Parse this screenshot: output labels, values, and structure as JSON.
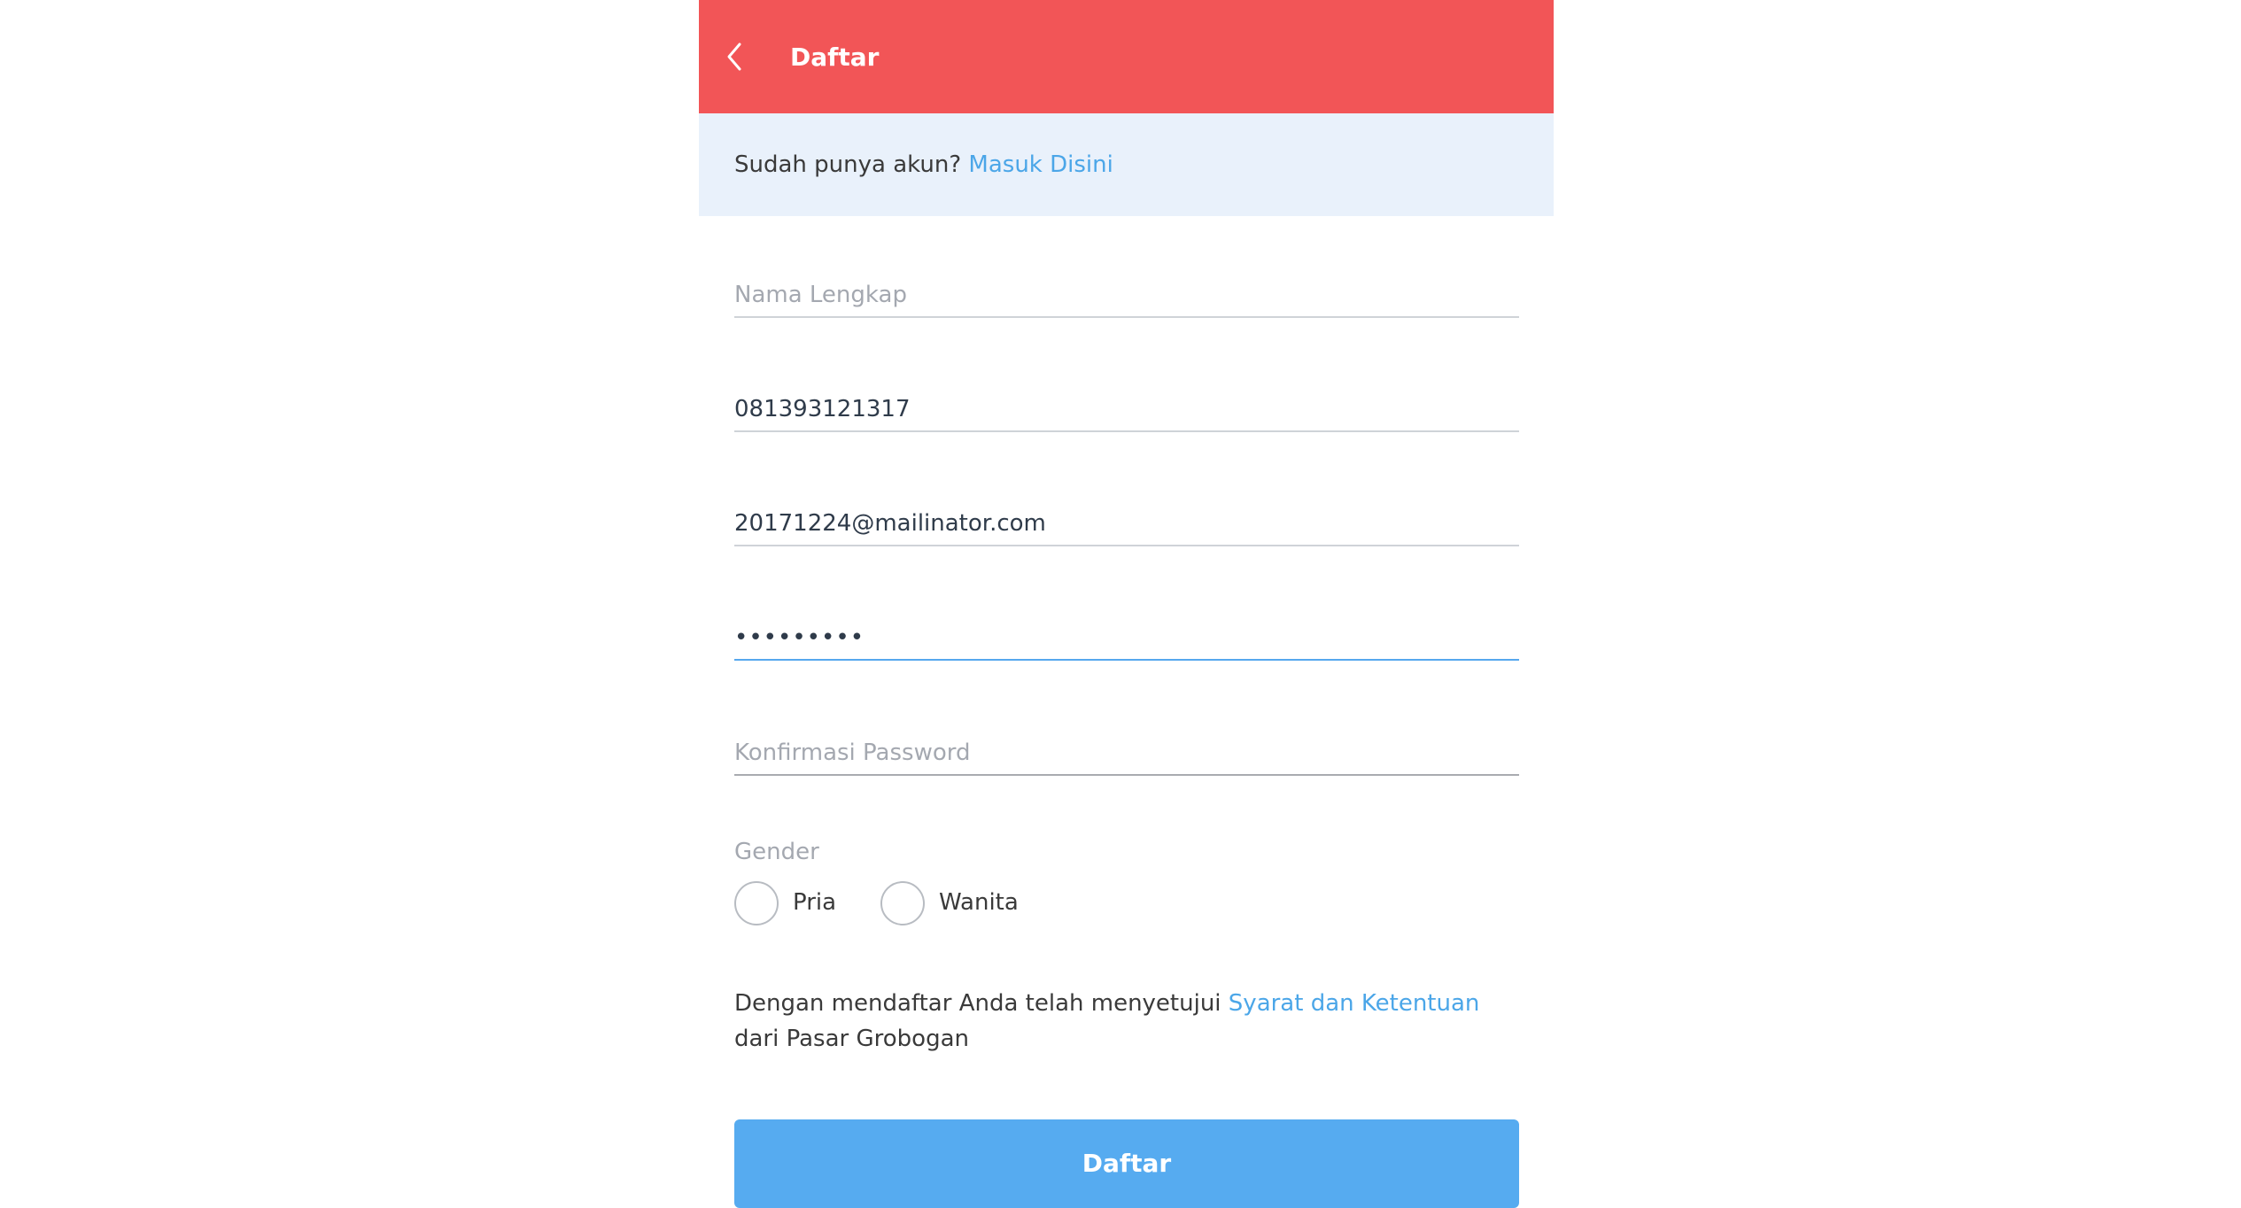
{
  "header": {
    "title": "Daftar",
    "back_icon": "chevron-left-icon",
    "background": "#f25557"
  },
  "login_prompt": {
    "text": "Sudah punya akun?",
    "link": "Masuk Disini"
  },
  "form": {
    "full_name": {
      "placeholder": "Nama Lengkap",
      "value": ""
    },
    "phone": {
      "value": "081393121317"
    },
    "email": {
      "value": "20171224@mailinator.com"
    },
    "password": {
      "value": "•••••••••"
    },
    "confirm_password": {
      "placeholder": "Konfirmasi Password",
      "value": ""
    },
    "gender": {
      "label": "Gender",
      "options": [
        "Pria",
        "Wanita"
      ],
      "selected": null
    }
  },
  "terms": {
    "prefix": "Dengan mendaftar Anda telah menyetujui",
    "link": "Syarat dan Ketentuan",
    "suffix": "dari Pasar Grobogan"
  },
  "submit_label": "Daftar",
  "colors": {
    "accent": "#56abf0",
    "link": "#4ba6e8",
    "banner": "#e9f1fb"
  }
}
